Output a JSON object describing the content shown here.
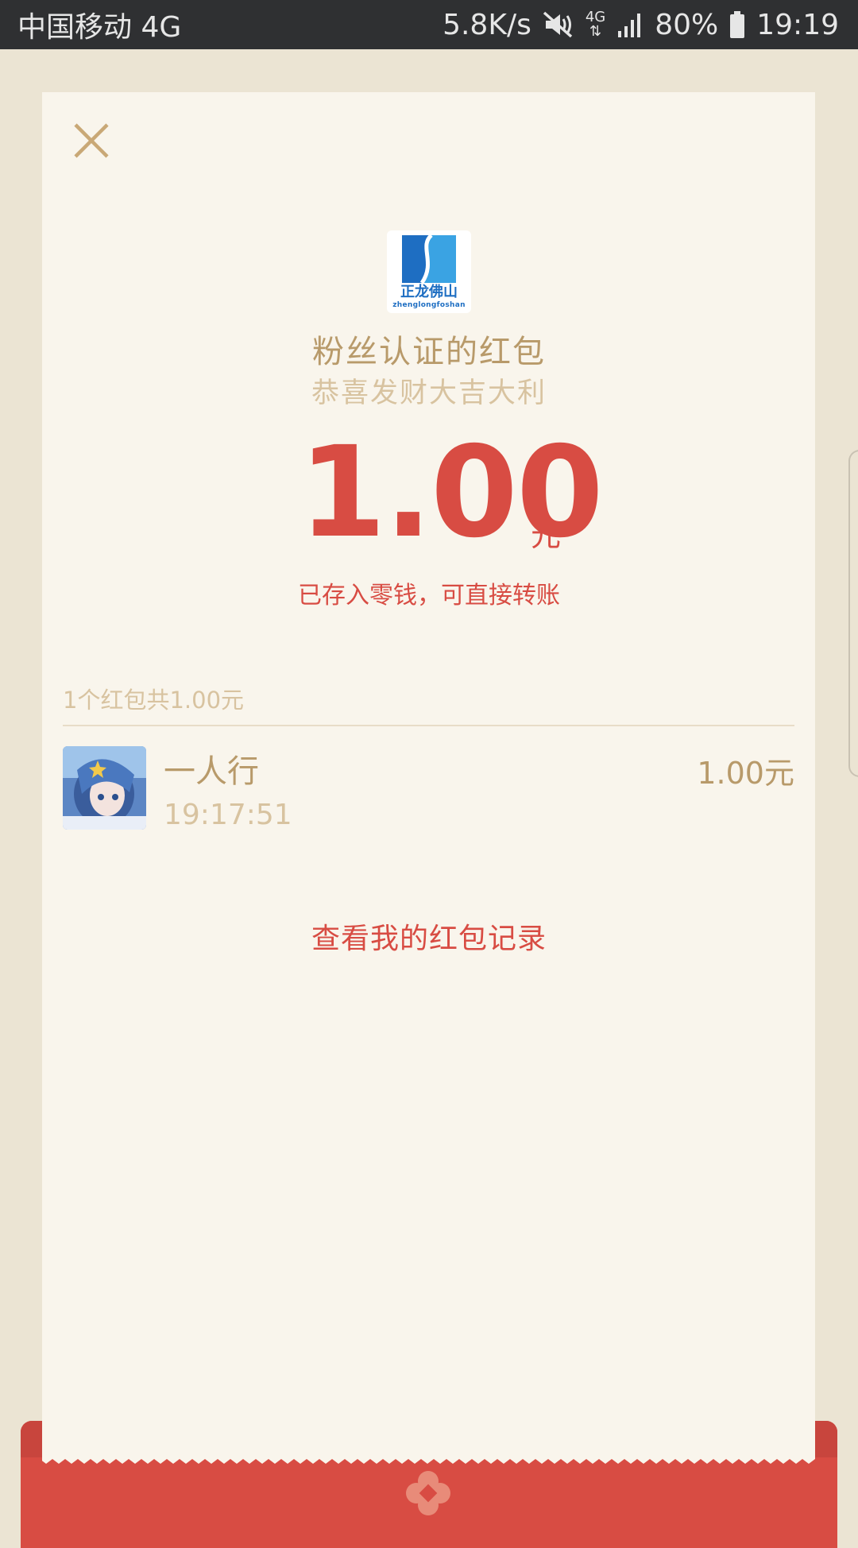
{
  "status_bar": {
    "carrier": "中国移动 4G",
    "speed": "5.8K/s",
    "network_type": "4G",
    "battery": "80%",
    "time": "19:19"
  },
  "packet": {
    "logo_text": "正龙佛山",
    "logo_subtext": "zhenglongfoshan",
    "title": "粉丝认证的红包",
    "greeting": "恭喜发财大吉大利",
    "amount": "1.00",
    "unit": "元",
    "notice": "已存入零钱，可直接转账"
  },
  "summary": "1个红包共1.00元",
  "recipients": [
    {
      "name": "一人行",
      "time": "19:17:51",
      "amount": "1.00元"
    }
  ],
  "records_link": "查看我的红包记录",
  "colors": {
    "accent_red": "#d84c43",
    "gold_text": "#b89a6a",
    "muted_text": "#d8c3a0",
    "card_bg": "#f9f5ec",
    "page_bg": "#ebe4d3",
    "logo_blue": "#1e6ec2"
  },
  "icons": [
    "mute-icon",
    "data-arrows-icon",
    "signal-icon",
    "battery-icon",
    "close-icon",
    "emblem-icon"
  ]
}
